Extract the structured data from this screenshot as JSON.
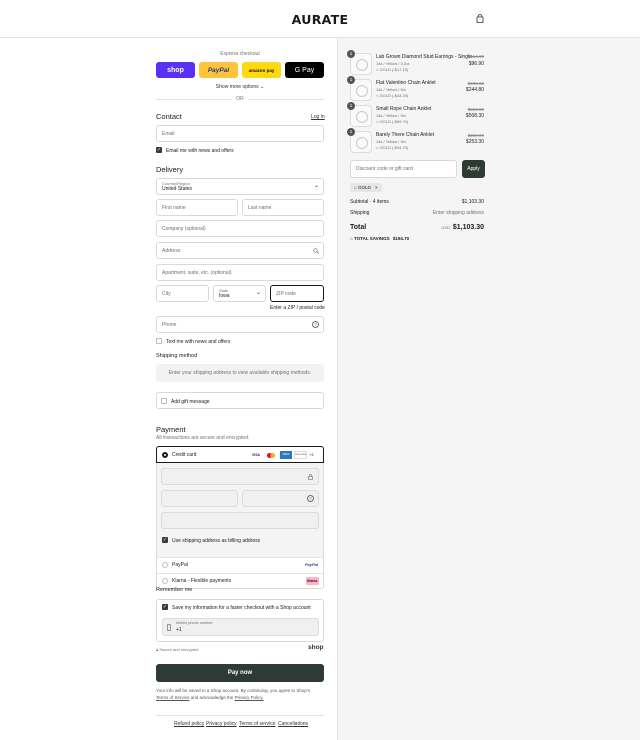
{
  "header": {
    "brand": "AURATE",
    "cart_icon": "shopping-bag-icon"
  },
  "express": {
    "title": "Express checkout",
    "buttons": [
      {
        "label": "shop",
        "color": "#5a31f4"
      },
      {
        "label": "PayPal",
        "color": "#ffc439"
      },
      {
        "label": "amazon pay",
        "color": "#ffd814"
      },
      {
        "label": "G Pay",
        "color": "#000000"
      }
    ],
    "more": "Show more options",
    "or": "OR"
  },
  "contact": {
    "title": "Contact",
    "login": "Log in",
    "email_placeholder": "Email",
    "news_label": "Email me with news and offers"
  },
  "delivery": {
    "title": "Delivery",
    "country_label": "Country/Region",
    "country_value": "United States",
    "first_name": "First name",
    "last_name": "Last name",
    "company": "Company (optional)",
    "address": "Address",
    "apartment": "Apartment, suite, etc. (optional)",
    "city": "City",
    "state_label": "State",
    "state_value": "Iowa",
    "zip": "ZIP code",
    "zip_error": "Enter a ZIP / postal code",
    "phone": "Phone",
    "sms_label": "Text me with news and offers"
  },
  "shipping": {
    "title": "Shipping method",
    "notice": "Enter your shipping address to view available shipping methods."
  },
  "gift": {
    "label": "Add gift message"
  },
  "payment": {
    "title": "Payment",
    "subtitle": "All transactions are secure and encrypted.",
    "credit_card": "Credit card",
    "card_brands": [
      "VISA",
      "MC",
      "AMEX",
      "DISCOVER",
      "+4"
    ],
    "billing_label": "Use shipping address as billing address",
    "paypal": "PayPal",
    "paypal_badge": "PayPal",
    "klarna": "Klarna - Flexible payments",
    "klarna_badge": "Klarna."
  },
  "remember": {
    "title": "Remember me",
    "save_label": "Save my information for a faster checkout with a Shop account",
    "phone_label": "Mobile phone number",
    "phone_value": "+1",
    "secure": "Secure and encrypted",
    "shop_logo": "shop"
  },
  "pay_button": "Pay now",
  "legal": {
    "line1": "Your info will be saved to a Shop account. By continuing, you agree to Shop's",
    "terms": "Terms of Service",
    "and": "and acknowledge the",
    "privacy": "Privacy Policy."
  },
  "footer": {
    "links": [
      "Refund policy",
      "Privacy policy",
      "Terms of service",
      "Cancellations"
    ]
  },
  "summary": {
    "items": [
      {
        "qty": "1",
        "name": "Lab Grown Diamond Stud Earrings - Single",
        "variant": "14k / Yellow / 3.0ct",
        "discount": "GOLD (-$17.15)",
        "old": "$114.00",
        "price": "$96.90"
      },
      {
        "qty": "1",
        "name": "Flat Valentino Chain Anklet",
        "variant": "14k / Yellow / 9in",
        "discount": "GOLD (-$43.20)",
        "old": "$288.00",
        "price": "$244.80"
      },
      {
        "qty": "1",
        "name": "Small Rope Chain Anklet",
        "variant": "14k / Yellow / 9in",
        "discount": "GOLD (-$89.70)",
        "old": "$598.00",
        "price": "$508.30"
      },
      {
        "qty": "1",
        "name": "Barely There Chain Anklet",
        "variant": "14k / Yellow / 9in",
        "discount": "GOLD (-$44.70)",
        "old": "$298.00",
        "price": "$253.30"
      }
    ],
    "discount_placeholder": "Discount code or gift card",
    "apply": "Apply",
    "code_tag": "GOLD",
    "subtotal_label": "Subtotal · 4 items",
    "subtotal_value": "$1,103.30",
    "shipping_label": "Shipping",
    "shipping_value": "Enter shipping address",
    "total_label": "Total",
    "currency": "USD",
    "total_value": "$1,103.30",
    "savings_label": "TOTAL SAVINGS",
    "savings_value": "$194.70"
  },
  "colors": {
    "accent": "#2e3b35",
    "error": "#1a1a1a"
  }
}
